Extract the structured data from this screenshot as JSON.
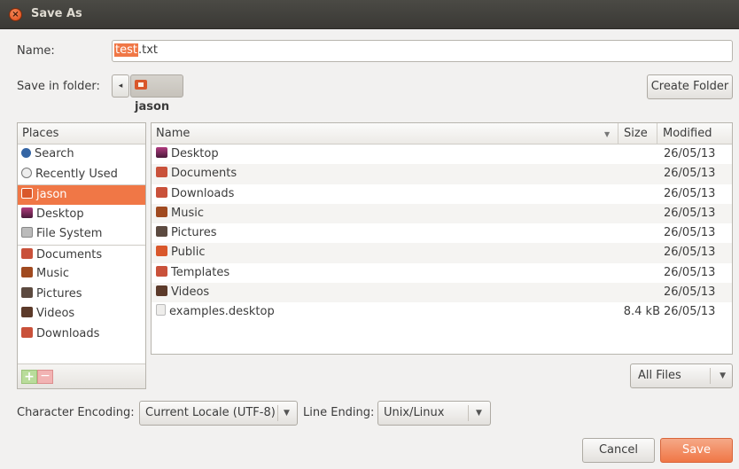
{
  "window": {
    "title": "Save As"
  },
  "name": {
    "label": "Name:",
    "value_selected": "test",
    "value_rest": ".txt"
  },
  "folder": {
    "label": "Save in folder:",
    "crumb": "jason",
    "create_folder": "Create Folder"
  },
  "places": {
    "header": "Places",
    "items": [
      {
        "label": "Search",
        "icon": "search-icon",
        "color": "#3465a4"
      },
      {
        "label": "Recently Used",
        "icon": "clock-icon",
        "color": "#777777"
      },
      {
        "label": "jason",
        "icon": "home-folder-icon",
        "color": "#ffffff",
        "active": true
      },
      {
        "label": "Desktop",
        "icon": "desktop-icon",
        "color": "#7a2a5e"
      },
      {
        "label": "File System",
        "icon": "drive-icon",
        "color": "#9a9a9a"
      },
      {
        "label": "Documents",
        "icon": "documents-folder-icon",
        "color": "#c9513a"
      },
      {
        "label": "Music",
        "icon": "music-folder-icon",
        "color": "#a04a20"
      },
      {
        "label": "Pictures",
        "icon": "pictures-folder-icon",
        "color": "#5c4a40"
      },
      {
        "label": "Videos",
        "icon": "videos-folder-icon",
        "color": "#5c3a2a"
      },
      {
        "label": "Downloads",
        "icon": "downloads-folder-icon",
        "color": "#c9513a"
      }
    ]
  },
  "files": {
    "columns": {
      "name": "Name",
      "size": "Size",
      "modified": "Modified"
    },
    "rows": [
      {
        "name": "Desktop",
        "size": "",
        "modified": "26/05/13",
        "icon": "desktop-icon",
        "color": "#7a2a5e"
      },
      {
        "name": "Documents",
        "size": "",
        "modified": "26/05/13",
        "icon": "documents-folder-icon",
        "color": "#c9513a"
      },
      {
        "name": "Downloads",
        "size": "",
        "modified": "26/05/13",
        "icon": "downloads-folder-icon",
        "color": "#c9513a"
      },
      {
        "name": "Music",
        "size": "",
        "modified": "26/05/13",
        "icon": "music-folder-icon",
        "color": "#a04a20"
      },
      {
        "name": "Pictures",
        "size": "",
        "modified": "26/05/13",
        "icon": "pictures-folder-icon",
        "color": "#5c4a40"
      },
      {
        "name": "Public",
        "size": "",
        "modified": "26/05/13",
        "icon": "public-folder-icon",
        "color": "#d9572b"
      },
      {
        "name": "Templates",
        "size": "",
        "modified": "26/05/13",
        "icon": "templates-folder-icon",
        "color": "#c9513a"
      },
      {
        "name": "Videos",
        "size": "",
        "modified": "26/05/13",
        "icon": "videos-folder-icon",
        "color": "#5c3a2a"
      },
      {
        "name": "examples.desktop",
        "size": "8.4 kB",
        "modified": "26/05/13",
        "icon": "file-icon",
        "color": "#d8d6d2"
      }
    ]
  },
  "filter": {
    "value": "All Files"
  },
  "encoding": {
    "label": "Character Encoding:",
    "value": "Current Locale (UTF-8)"
  },
  "line_ending": {
    "label": "Line Ending:",
    "value": "Unix/Linux"
  },
  "actions": {
    "cancel": "Cancel",
    "save": "Save"
  },
  "accent_color": "#f07746"
}
